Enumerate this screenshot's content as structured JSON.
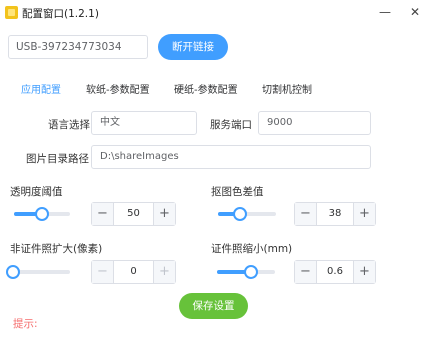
{
  "window": {
    "title": "配置窗口(1.2.1)",
    "controls": {
      "minimize": "—",
      "close": "✕"
    }
  },
  "connection": {
    "device_id": "USB-397234773034",
    "disconnect_label": "断开链接"
  },
  "tabs": [
    {
      "label": "应用配置",
      "active": true
    },
    {
      "label": "软纸-参数配置",
      "active": false
    },
    {
      "label": "硬纸-参数配置",
      "active": false
    },
    {
      "label": "切割机控制",
      "active": false
    }
  ],
  "app_config": {
    "language_label": "语言选择",
    "language_value": "中文",
    "port_label": "服务端口",
    "port_value": "9000",
    "image_dir_label": "图片目录路径",
    "image_dir_value": "D:\\shareImages"
  },
  "params": {
    "transparency": {
      "label": "透明度阈值",
      "value": "50",
      "slider_level": 0.5
    },
    "color_diff": {
      "label": "抠图色差值",
      "value": "38",
      "slider_level": 0.38
    },
    "non_cert_enlarge": {
      "label": "非证件照扩大(像素)",
      "value": "0",
      "slider_level": 0.0
    },
    "cert_shrink": {
      "label": "证件照缩小(mm)",
      "value": "0.6",
      "slider_level": 0.6
    }
  },
  "stepper_symbols": {
    "minus": "−",
    "plus": "+"
  },
  "save_label": "保存设置",
  "hint_label": "提示:",
  "colors": {
    "primary": "#409eff",
    "success": "#67c23a",
    "danger": "#f56c6c",
    "app_icon": "#f2c31c"
  }
}
